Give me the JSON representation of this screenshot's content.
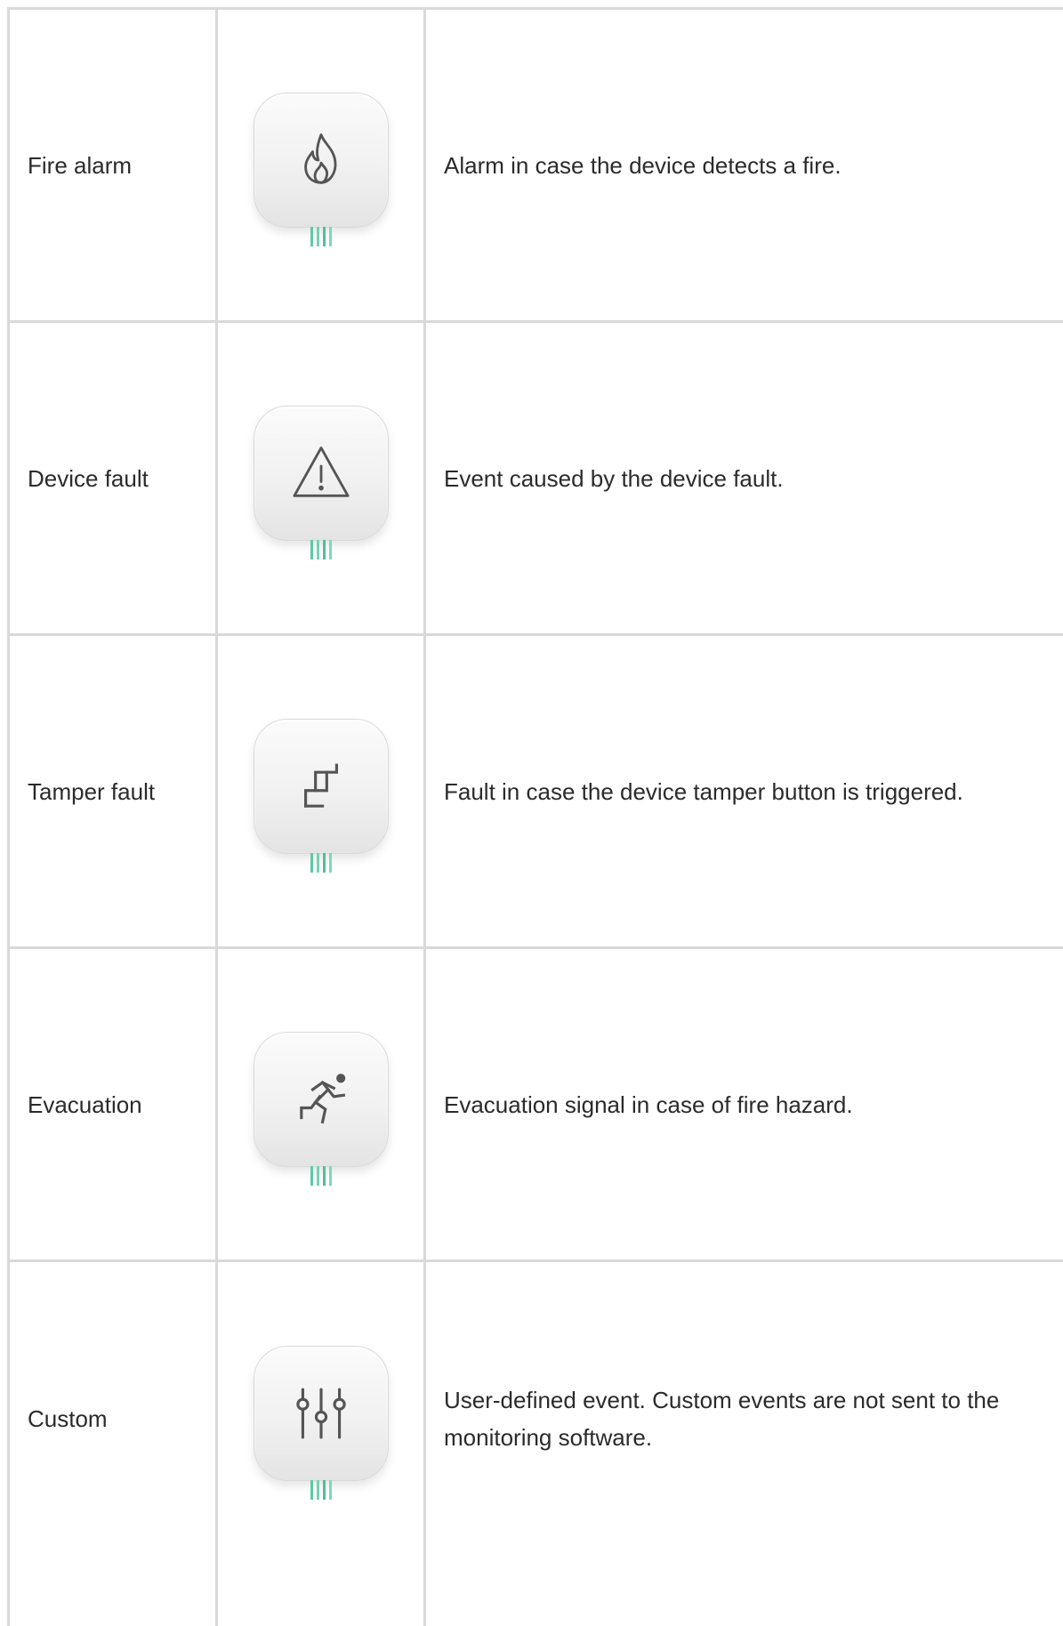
{
  "rows": [
    {
      "name": "Fire alarm",
      "icon": "fire-icon",
      "description": "Alarm in case the device detects a fire."
    },
    {
      "name": "Device fault",
      "icon": "warning-triangle-icon",
      "description": "Event caused by the device fault."
    },
    {
      "name": "Tamper fault",
      "icon": "tamper-icon",
      "description": "Fault in case the device tamper button is triggered."
    },
    {
      "name": "Evacuation",
      "icon": "evacuation-runner-icon",
      "description": "Evacuation signal in case of fire hazard."
    },
    {
      "name": "Custom",
      "icon": "sliders-icon",
      "description": "User-defined event. Custom events are not sent to the monitoring software."
    }
  ],
  "colors": {
    "grid": "#d9d9d9",
    "text": "#2b2b2b",
    "icon": "#555555",
    "wire": "#5cc9a7"
  }
}
